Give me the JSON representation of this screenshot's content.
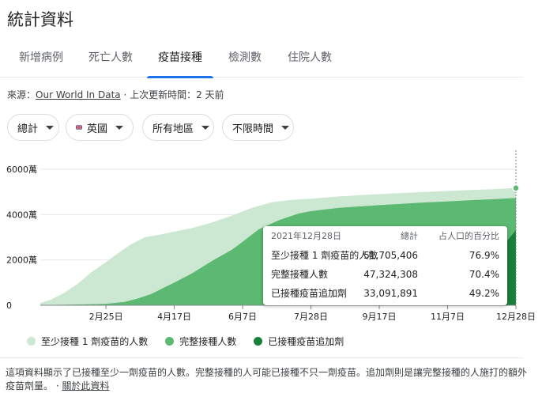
{
  "page_title": "統計資料",
  "tabs": [
    {
      "label": "新增病例"
    },
    {
      "label": "死亡人數"
    },
    {
      "label": "疫苗接種"
    },
    {
      "label": "檢測數"
    },
    {
      "label": "住院人數"
    }
  ],
  "active_tab_index": 2,
  "source": {
    "prefix": "來源：",
    "link": "Our World In Data",
    "separator": " · ",
    "updated": "上次更新時間：2 天前"
  },
  "filters": {
    "measure": "總計",
    "country": "英國",
    "region": "所有地區",
    "time": "不限時間",
    "country_flag_icon": "uk-flag-icon"
  },
  "tooltip": {
    "date": "2021年12月28日",
    "col_total": "總計",
    "col_pct": "占人口的百分比",
    "rows": [
      {
        "label": "至少接種 1 劑疫苗的人數",
        "total": "51,705,406",
        "pct": "76.9%"
      },
      {
        "label": "完整接種人數",
        "total": "47,324,308",
        "pct": "70.4%"
      },
      {
        "label": "已接種疫苗追加劑",
        "total": "33,091,891",
        "pct": "49.2%"
      }
    ]
  },
  "legend": [
    {
      "label": "至少接種 1 劑疫苗的人數",
      "color": "#cce8d3"
    },
    {
      "label": "完整接種人數",
      "color": "#5bb971"
    },
    {
      "label": "已接種疫苗追加劑",
      "color": "#188038"
    }
  ],
  "note": {
    "text": "這項資料顯示了已接種至少一劑疫苗的人數。完整接種的人可能已接種不只一劑疫苗。追加劑則是讓完整接種的人施打的額外疫苗劑量。",
    "separator": " · ",
    "link": "關於此資料"
  },
  "chart_data": {
    "type": "area",
    "y_tick_labels": [
      "6000萬",
      "4000萬",
      "2000萬",
      "0"
    ],
    "ylim": [
      0,
      60000000
    ],
    "yticks": [
      60000000,
      40000000,
      20000000,
      0
    ],
    "x_tick_labels": [
      "2月25日",
      "4月17日",
      "6月7日",
      "7月28日",
      "9月17日",
      "11月7日",
      "12月28日"
    ],
    "x_ticks_day": [
      56,
      107,
      158,
      209,
      260,
      311,
      362
    ],
    "xlim_day": [
      7,
      362
    ],
    "colors": {
      "first": "#cce8d3",
      "full": "#5bb971",
      "booster": "#188038"
    },
    "series": [
      {
        "name": "至少接種 1 劑疫苗的人數",
        "x_day": [
          7,
          15,
          25,
          35,
          45,
          56,
          65,
          75,
          85,
          95,
          107,
          120,
          135,
          150,
          165,
          180,
          195,
          209,
          230,
          250,
          270,
          290,
          310,
          330,
          345,
          362
        ],
        "values": [
          1000000,
          2500000,
          5500000,
          9500000,
          14500000,
          19000000,
          23000000,
          27000000,
          30000000,
          31000000,
          32500000,
          34000000,
          36500000,
          39500000,
          43000000,
          45500000,
          46500000,
          47000000,
          48000000,
          48700000,
          49300000,
          49900000,
          50400000,
          50900000,
          51200000,
          51705406
        ]
      },
      {
        "name": "完整接種人數",
        "x_day": [
          7,
          56,
          70,
          80,
          90,
          100,
          107,
          120,
          135,
          150,
          158,
          170,
          185,
          200,
          209,
          230,
          250,
          270,
          290,
          310,
          330,
          345,
          362
        ],
        "values": [
          0,
          600000,
          1500000,
          3000000,
          5000000,
          8000000,
          10000000,
          14000000,
          19500000,
          24500000,
          28000000,
          33500000,
          37500000,
          40500000,
          41500000,
          43000000,
          43800000,
          44500000,
          45200000,
          45800000,
          46400000,
          46800000,
          47324308
        ]
      },
      {
        "name": "已接種疫苗追加劑",
        "x_day": [
          7,
          340,
          352,
          362
        ],
        "values": [
          0,
          0,
          26000000,
          33091891
        ]
      }
    ]
  }
}
